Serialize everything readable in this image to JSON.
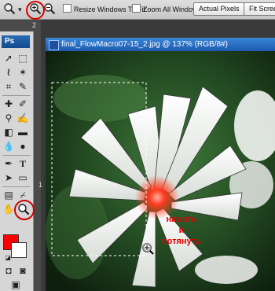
{
  "options_bar": {
    "zoom_in_icon": "zoom-in-icon",
    "zoom_out_icon": "zoom-out-icon",
    "resize_windows_label": "Resize Windows To Fit",
    "zoom_all_windows_label": "Zoom All Windows",
    "actual_pixels_label": "Actual Pixels",
    "fit_screen_label": "Fit Screen"
  },
  "toolbox": {
    "logo": "Ps",
    "foreground_color": "#ff0000",
    "background_color": "#ffffff"
  },
  "document": {
    "title": "final_FlowMacro07-15_2.jpg @ 137% (RGB/8#)"
  },
  "annotation": {
    "line1": "нажать",
    "line2": "и",
    "line3": "потянуть",
    "color": "#e00000"
  },
  "ruler_markers": {
    "top_mark": "2",
    "left_mark": "1"
  }
}
